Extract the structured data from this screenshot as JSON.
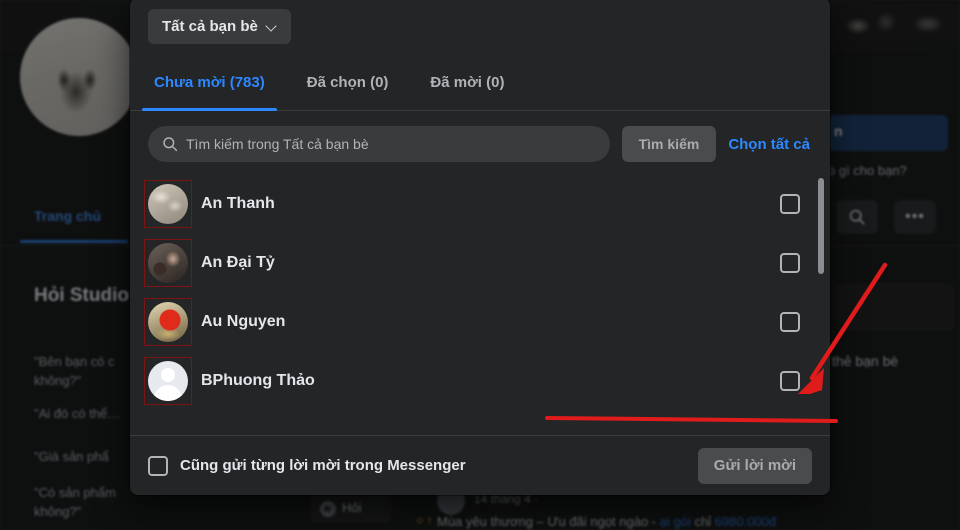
{
  "dialog": {
    "audience_button": "Tất cả bạn bè",
    "tabs": [
      {
        "label": "Chưa mời (783)",
        "active": true
      },
      {
        "label": "Đã chọn (0)",
        "active": false
      },
      {
        "label": "Đã mời (0)",
        "active": false
      }
    ],
    "search": {
      "placeholder": "Tìm kiếm trong Tất cả bạn bè",
      "value": "",
      "button_label": "Tìm kiếm",
      "select_all_label": "Chọn tất cả"
    },
    "friends": [
      {
        "name": "An Thanh",
        "checked": false
      },
      {
        "name": "An Đại Tỷ",
        "checked": false
      },
      {
        "name": "Au Nguyen",
        "checked": false
      },
      {
        "name": "BPhuong Thảo",
        "checked": false
      }
    ],
    "footer": {
      "messenger_label": "Cũng gửi từng lời mời trong Messenger",
      "messenger_checked": false,
      "send_label": "Gửi lời mời"
    }
  },
  "background": {
    "nav_item": "Trang chủ",
    "headline": "Hỏi Studio\ncưới đẹp",
    "questions": [
      "\"Bên bạn có c\nkhông?\"",
      "\"Ai đó có thể…",
      "\"Giá sản phẩ",
      "\"Có sản phẩm\nkhông?\""
    ],
    "blue_button": "n",
    "intro_text": "o gì cho bạn?",
    "friends_label": "thẻ bạn bè",
    "hoi_chip": "Hỏi",
    "post_date": "14 tháng 4 ·",
    "post_text_pre": "Mùa yêu thương – Ưu đãi ngọt ngào - ",
    "post_text_hl": "ại gói",
    "post_text_mid": " chỉ ",
    "post_text_price": "6980.000đ",
    "post_reacts": "○ ↑"
  },
  "annotations": {
    "accent_color": "#e01b1b",
    "avatar_box_color": "#7d1414"
  }
}
